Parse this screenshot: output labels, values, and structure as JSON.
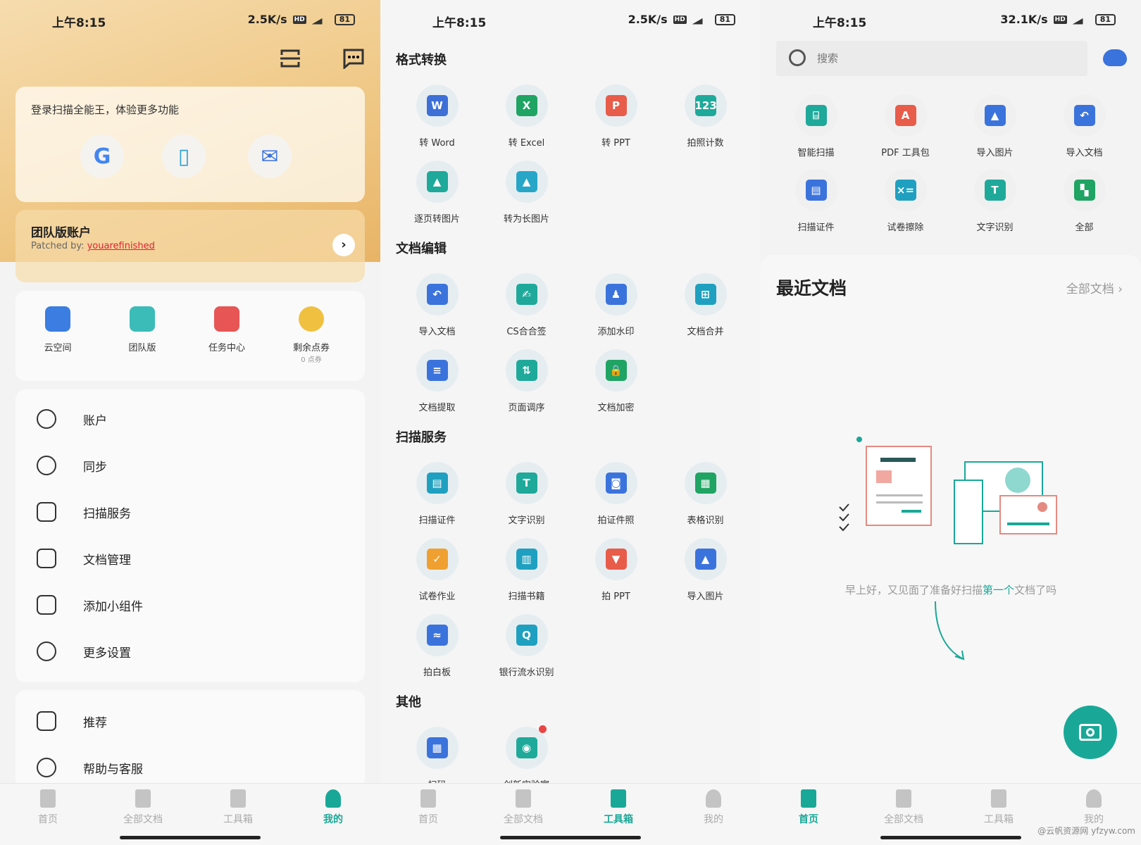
{
  "status": [
    {
      "time": "上午8:15",
      "speed": "2.5K/s",
      "battery": "81"
    },
    {
      "time": "上午8:15",
      "speed": "2.5K/s",
      "battery": "81"
    },
    {
      "time": "上午8:15",
      "speed": "32.1K/s",
      "battery": "81"
    }
  ],
  "colors": {
    "accent": "#19a897",
    "brand_bg": "#efc784"
  },
  "mine": {
    "header_icons": [
      "scan-icon",
      "message-icon"
    ],
    "login": {
      "title": "登录扫描全能王，体验更多功能",
      "buttons": [
        {
          "icon": "google-icon",
          "glyph": "G"
        },
        {
          "icon": "phone-icon",
          "glyph": "▯"
        },
        {
          "icon": "mail-icon",
          "glyph": "✉"
        }
      ]
    },
    "team": {
      "title": "团队版账户",
      "patched_prefix": "Patched by: ",
      "patched_user": "youarefinished"
    },
    "quick": [
      {
        "label": "云空间",
        "color": "#3b7de0"
      },
      {
        "label": "团队版",
        "color": "#3bbcb8"
      },
      {
        "label": "任务中心",
        "color": "#e85555"
      },
      {
        "label": "剩余点券",
        "sub": "0 点券",
        "color": "#f0c040"
      }
    ],
    "menu": [
      {
        "label": "账户",
        "icon": "user-icon"
      },
      {
        "label": "同步",
        "icon": "cloud-sync-icon"
      },
      {
        "label": "扫描服务",
        "icon": "scan-text-icon"
      },
      {
        "label": "文档管理",
        "icon": "document-icon"
      },
      {
        "label": "添加小组件",
        "icon": "widget-icon"
      },
      {
        "label": "更多设置",
        "icon": "gear-icon"
      }
    ],
    "menu2": [
      {
        "label": "推荐",
        "icon": "thumbs-up-icon"
      },
      {
        "label": "帮助与客服",
        "icon": "help-icon"
      }
    ]
  },
  "nav": {
    "items": [
      "首页",
      "全部文档",
      "工具箱",
      "我的"
    ],
    "active": [
      3,
      2,
      0
    ]
  },
  "toolbox": {
    "sections": [
      {
        "title": "格式转换",
        "tools": [
          {
            "label": "转 Word",
            "g": "W",
            "c": "#3d6fd6"
          },
          {
            "label": "转 Excel",
            "g": "X",
            "c": "#1fa463"
          },
          {
            "label": "转 PPT",
            "g": "P",
            "c": "#e85c4a"
          },
          {
            "label": "拍照计数",
            "g": "123",
            "c": "#1fa99a"
          },
          {
            "label": "逐页转图片",
            "g": "▲",
            "c": "#1fa99a"
          },
          {
            "label": "转为长图片",
            "g": "▲",
            "c": "#28a6c8"
          }
        ]
      },
      {
        "title": "文档编辑",
        "tools": [
          {
            "label": "导入文档",
            "g": "↶",
            "c": "#3b73dc"
          },
          {
            "label": "CS合合签",
            "g": "✍",
            "c": "#1fa99a"
          },
          {
            "label": "添加水印",
            "g": "♟",
            "c": "#3b73dc"
          },
          {
            "label": "文档合并",
            "g": "⊞",
            "c": "#1fa0c0"
          },
          {
            "label": "文档提取",
            "g": "≡",
            "c": "#3b73dc"
          },
          {
            "label": "页面调序",
            "g": "⇅",
            "c": "#1fa99a"
          },
          {
            "label": "文档加密",
            "g": "🔒",
            "c": "#1fa463"
          }
        ]
      },
      {
        "title": "扫描服务",
        "tools": [
          {
            "label": "扫描证件",
            "g": "▤",
            "c": "#1fa0c0"
          },
          {
            "label": "文字识别",
            "g": "T",
            "c": "#1fa99a"
          },
          {
            "label": "拍证件照",
            "g": "◙",
            "c": "#3b73dc"
          },
          {
            "label": "表格识别",
            "g": "▦",
            "c": "#1fa463"
          },
          {
            "label": "试卷作业",
            "g": "✓",
            "c": "#f0a030"
          },
          {
            "label": "扫描书籍",
            "g": "▥",
            "c": "#1fa0c0"
          },
          {
            "label": "拍 PPT",
            "g": "▼",
            "c": "#e85c4a"
          },
          {
            "label": "导入图片",
            "g": "▲",
            "c": "#3b73dc"
          },
          {
            "label": "拍白板",
            "g": "≈",
            "c": "#3b73dc"
          },
          {
            "label": "银行流水识别",
            "g": "Q",
            "c": "#1fa0c0"
          }
        ]
      },
      {
        "title": "其他",
        "tools": [
          {
            "label": "扫码",
            "g": "▦",
            "c": "#3b73dc"
          },
          {
            "label": "创新实验室",
            "g": "◉",
            "c": "#1fa99a",
            "badge": true
          }
        ]
      }
    ]
  },
  "home": {
    "search_placeholder": "搜索",
    "tools": [
      {
        "label": "智能扫描",
        "g": "⌸",
        "c": "#1fa99a"
      },
      {
        "label": "PDF 工具包",
        "g": "A",
        "c": "#e85c4a"
      },
      {
        "label": "导入图片",
        "g": "▲",
        "c": "#3b73dc"
      },
      {
        "label": "导入文档",
        "g": "↶",
        "c": "#3b73dc"
      },
      {
        "label": "扫描证件",
        "g": "▤",
        "c": "#3b73dc"
      },
      {
        "label": "试卷擦除",
        "g": "×=",
        "c": "#1fa0c0"
      },
      {
        "label": "文字识别",
        "g": "T",
        "c": "#1fa99a"
      },
      {
        "label": "全部",
        "g": "▚",
        "c": "#1fa463"
      }
    ],
    "recent_title": "最近文档",
    "all_docs": "全部文档",
    "empty_prefix": "早上好，又见面了准备好扫描",
    "empty_highlight": "第一个",
    "empty_suffix": "文档了吗",
    "watermark": "@云帆资源网 yfzyw.com"
  }
}
